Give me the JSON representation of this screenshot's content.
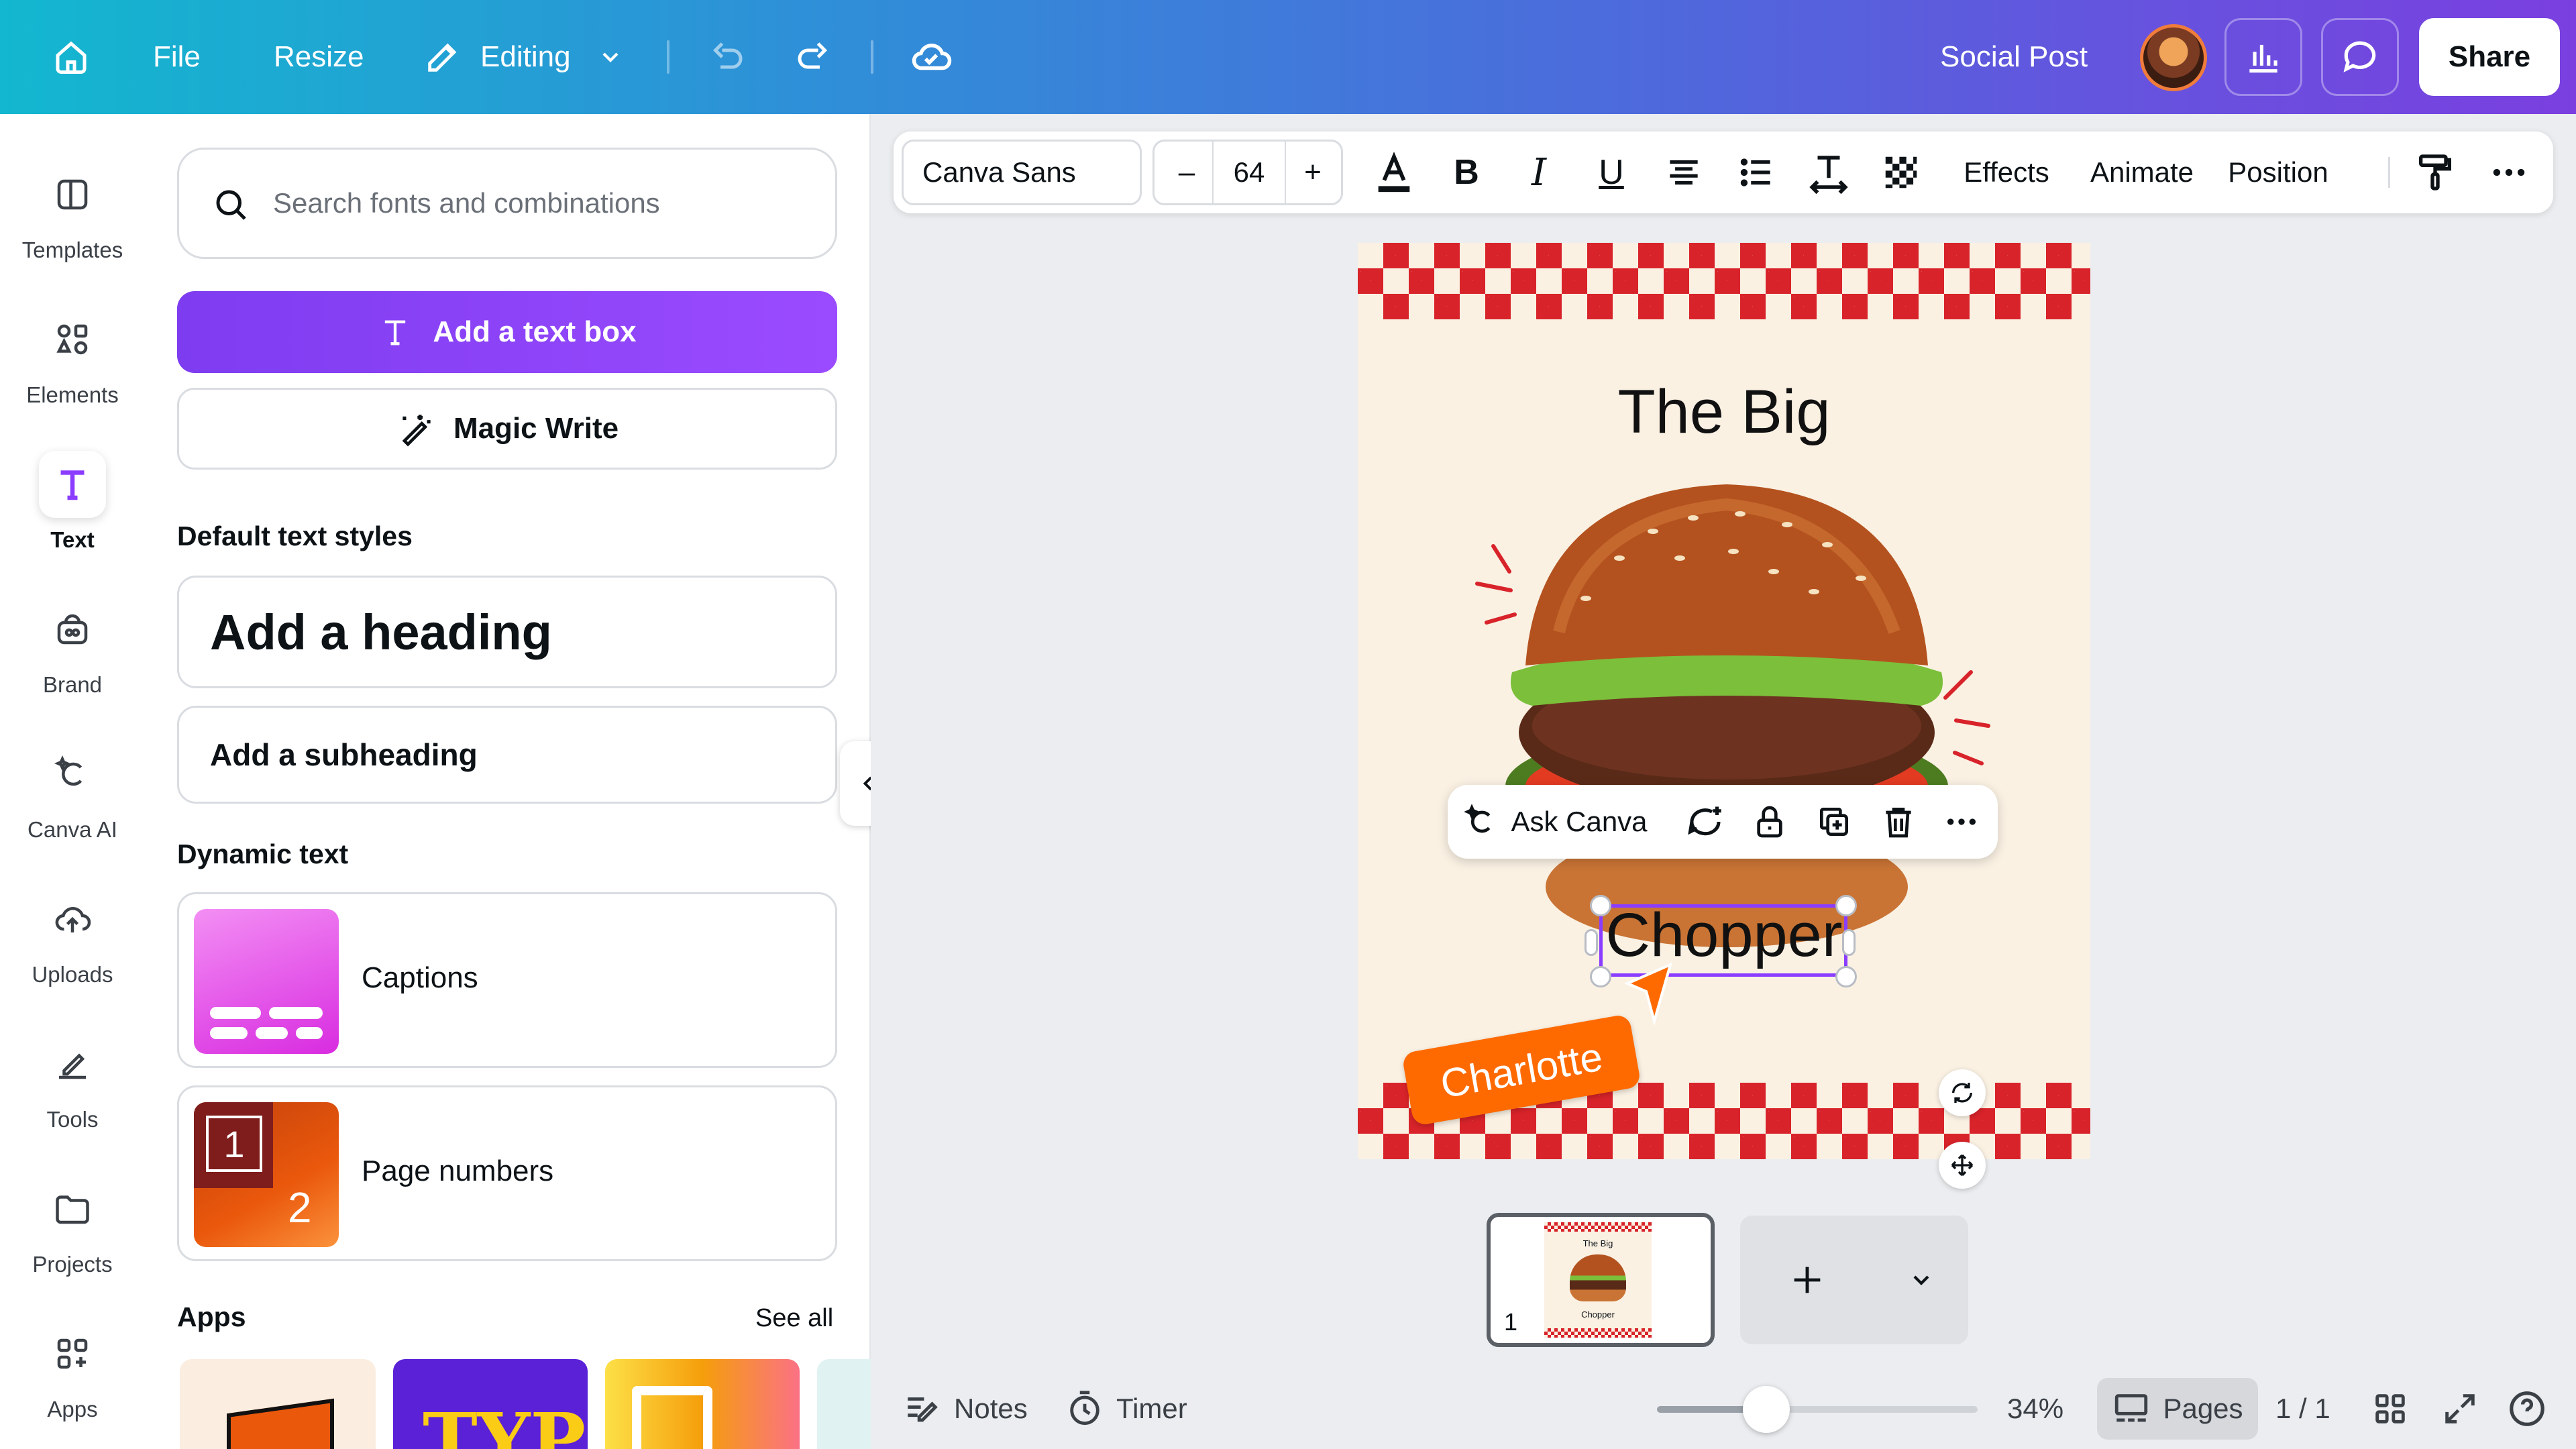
{
  "topbar": {
    "file": "File",
    "resize": "Resize",
    "editing": "Editing",
    "design_name": "Social Post",
    "share": "Share"
  },
  "rail": [
    {
      "label": "Templates",
      "icon": "templates-icon"
    },
    {
      "label": "Elements",
      "icon": "elements-icon"
    },
    {
      "label": "Text",
      "icon": "text-icon",
      "active": true
    },
    {
      "label": "Brand",
      "icon": "brand-icon"
    },
    {
      "label": "Canva AI",
      "icon": "canva-ai-icon"
    },
    {
      "label": "Uploads",
      "icon": "uploads-icon"
    },
    {
      "label": "Tools",
      "icon": "tools-icon"
    },
    {
      "label": "Projects",
      "icon": "projects-icon"
    },
    {
      "label": "Apps",
      "icon": "apps-icon"
    }
  ],
  "panel": {
    "search_placeholder": "Search fonts and combinations",
    "add_text_box": "Add a text box",
    "magic_write": "Magic Write",
    "default_styles_title": "Default text styles",
    "add_heading": "Add a heading",
    "add_subheading": "Add a subheading",
    "dynamic_title": "Dynamic text",
    "captions": "Captions",
    "page_numbers": "Page numbers",
    "page_number_badge": "2",
    "page_number_frame": "1",
    "apps_title": "Apps",
    "see_all": "See all",
    "app_tile_2_text": "TYPE"
  },
  "toolbar": {
    "font": "Canva Sans",
    "size": "64",
    "minus": "–",
    "plus": "+",
    "bold": "B",
    "italic": "I",
    "underline": "U",
    "effects": "Effects",
    "animate": "Animate",
    "position": "Position"
  },
  "canvas": {
    "title_line1": "The Big",
    "title_line2": "Chopper",
    "collaborator": "Charlotte",
    "ask_canva": "Ask Canva",
    "colors": {
      "checker": "#d8232a",
      "background": "#faf1e3",
      "accent": "#8b3dff",
      "cursor": "#ff6a00"
    }
  },
  "pages": {
    "thumb_number": "1",
    "thumb_title": "The Big",
    "thumb_sub": "Chopper"
  },
  "bottombar": {
    "notes": "Notes",
    "timer": "Timer",
    "zoom": "34%",
    "zoom_fraction": 0.34,
    "pages": "Pages",
    "page_count": "1 / 1"
  }
}
